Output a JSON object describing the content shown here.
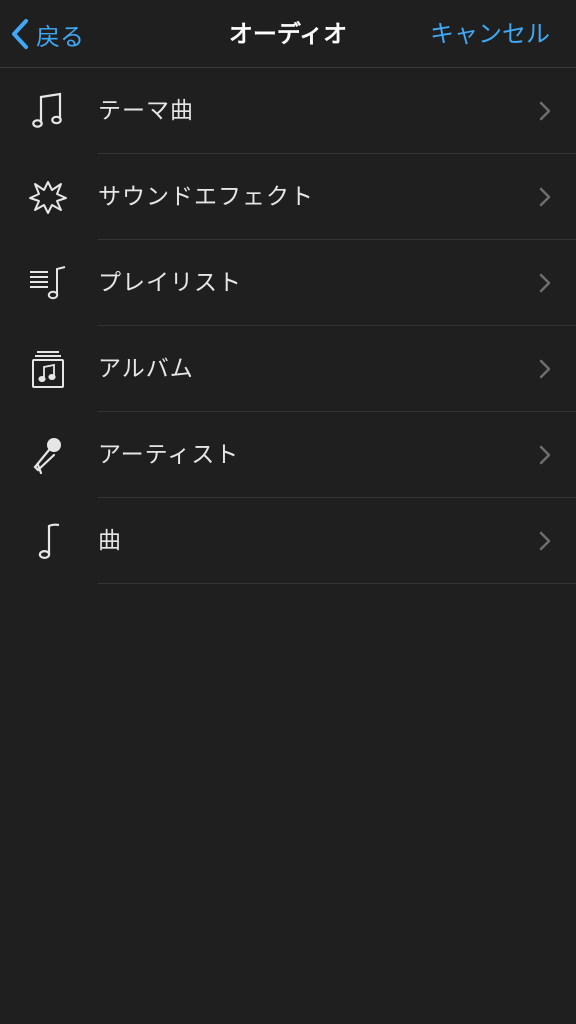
{
  "navbar": {
    "back_label": "戻る",
    "title": "オーディオ",
    "cancel_label": "キャンセル"
  },
  "colors": {
    "accent": "#3fa9f5",
    "background": "#1f1f1f",
    "text": "#e6e6e6"
  },
  "menu": [
    {
      "icon": "music-notes-icon",
      "label": "テーマ曲"
    },
    {
      "icon": "starburst-icon",
      "label": "サウンドエフェクト"
    },
    {
      "icon": "playlist-icon",
      "label": "プレイリスト"
    },
    {
      "icon": "album-icon",
      "label": "アルバム"
    },
    {
      "icon": "microphone-icon",
      "label": "アーティスト"
    },
    {
      "icon": "music-note-icon",
      "label": "曲"
    }
  ]
}
